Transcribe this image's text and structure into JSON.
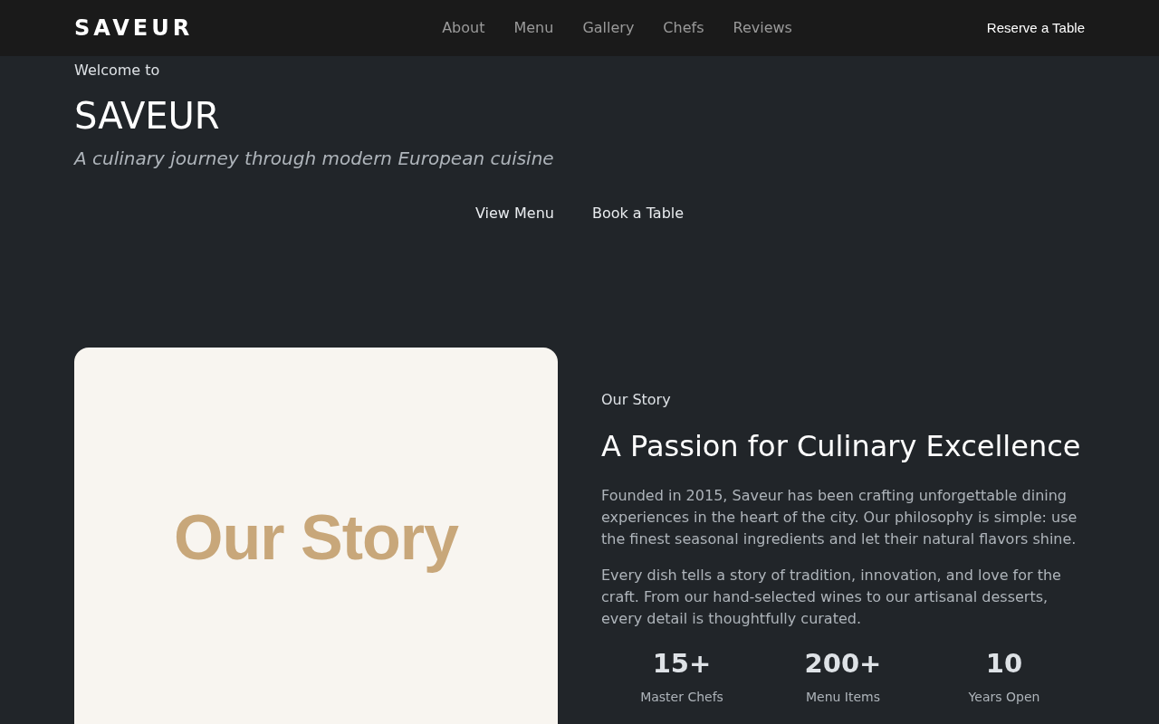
{
  "navbar": {
    "brand": "SAVEUR",
    "links": [
      {
        "label": "About"
      },
      {
        "label": "Menu"
      },
      {
        "label": "Gallery"
      },
      {
        "label": "Chefs"
      },
      {
        "label": "Reviews"
      }
    ],
    "cta": "Reserve a Table"
  },
  "hero": {
    "eyebrow": "Welcome to",
    "title": "SAVEUR",
    "subtitle": "A culinary journey through modern European cuisine",
    "buttons": [
      "View Menu",
      "Book a Table"
    ]
  },
  "story": {
    "image_text": "Our Story",
    "eyebrow": "Our Story",
    "heading": "A Passion for Culinary Excellence",
    "paragraphs": [
      "Founded in 2015, Saveur has been crafting unforgettable dining experiences in the heart of the city. Our philosophy is simple: use the finest seasonal ingredients and let their natural flavors shine.",
      "Every dish tells a story of tradition, innovation, and love for the craft. From our hand-selected wines to our artisanal desserts, every detail is thoughtfully curated."
    ],
    "stats": [
      {
        "value": "15+",
        "label": "Master Chefs"
      },
      {
        "value": "200+",
        "label": "Menu Items"
      },
      {
        "value": "10",
        "label": "Years Open"
      }
    ]
  }
}
